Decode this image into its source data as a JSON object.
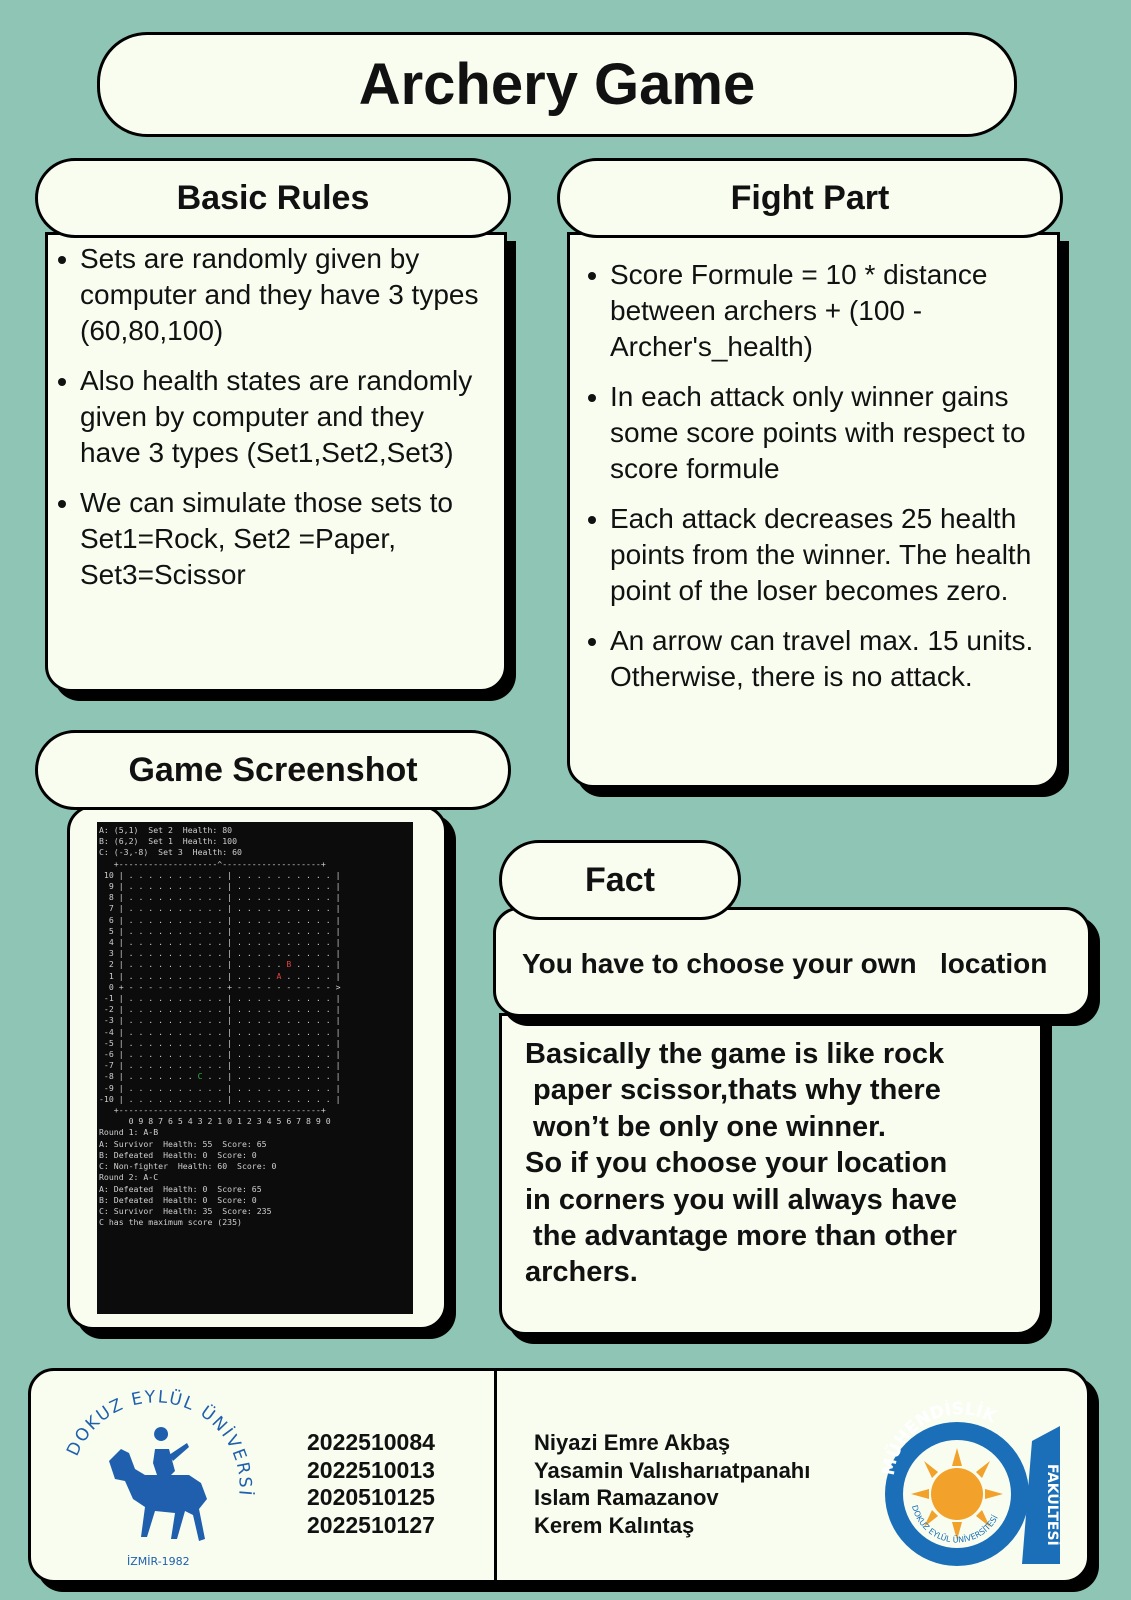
{
  "title": "Archery Game",
  "basic_rules": {
    "heading": "Basic Rules",
    "items": [
      "Sets are randomly given by computer and they have 3 types (60,80,100)",
      " Also health states are randomly given      by computer and they have 3 types (Set1,Set2,Set3)",
      " We can simulate those sets to Set1=Rock, Set2 =Paper, Set3=Scissor"
    ]
  },
  "fight_part": {
    "heading": "Fight Part",
    "items": [
      "Score Formule = 10 * distance between archers + (100 - Archer's_health)",
      "In each attack only winner gains some score points with respect to score formule",
      "Each attack decreases 25 health points from the winner. The health point of the loser becomes zero.",
      "An arrow can travel max. 15 units. Otherwise, there is no attack."
    ]
  },
  "game_screenshot": {
    "heading": "Game Screenshot",
    "header_lines": [
      "A: (5,1)  Set 2  Health: 80",
      "B: (6,2)  Set 1  Health: 100",
      "C: (-3,-8)  Set 3  Health: 60"
    ],
    "axis_x_labels": "0 9 8 7 6 5 4 3 2 1 0 1 2 3 4 5 6 7 8 9 0",
    "grid_markers": {
      "A": "A",
      "B": "B",
      "C": "C"
    },
    "result_lines": [
      "Round 1: A-B",
      "",
      "A: Survivor  Health: 55  Score: 65",
      "B: Defeated  Health: 0  Score: 0",
      "C: Non-fighter  Health: 60  Score: 0",
      "",
      "Round 2: A-C",
      "",
      "A: Defeated  Health: 0  Score: 65",
      "B: Defeated  Health: 0  Score: 0",
      "C: Survivor  Health: 35  Score: 235",
      "",
      "C has the maximum score (235)"
    ]
  },
  "fact": {
    "heading": "Fact",
    "banner": "You have to choose your own   location",
    "body": "Basically the game is like rock\n paper scissor,thats why there\n won’t be only one winner.\nSo if you choose your location\nin corners you will always have\n the advantage more than other\narchers."
  },
  "footer": {
    "student_ids": [
      "2022510084",
      "2022510013",
      "2020510125",
      "2022510127"
    ],
    "names": [
      "Niyazi Emre Akbaş",
      "Yasamin Valısharıatpanahı",
      "Islam Ramazanov",
      "Kerem Kalıntaş"
    ],
    "university_logo": {
      "icon": "horse-rider-logo",
      "arc_text": "DOKUZ EYLÜL ÜNİVERSİTESİ",
      "caption": "İZMİR-1982",
      "color": "#1f5fae"
    },
    "faculty_logo": {
      "icon": "sun-emblem-logo",
      "top_text": "MÜHENDİSLİK",
      "side_text": "FAKÜLTESİ",
      "ring_text": "DOKUZ EYLÜL ÜNİVERSİTESİ",
      "colors": {
        "blue": "#1a6fb8",
        "sun": "#f2a22a"
      }
    }
  }
}
